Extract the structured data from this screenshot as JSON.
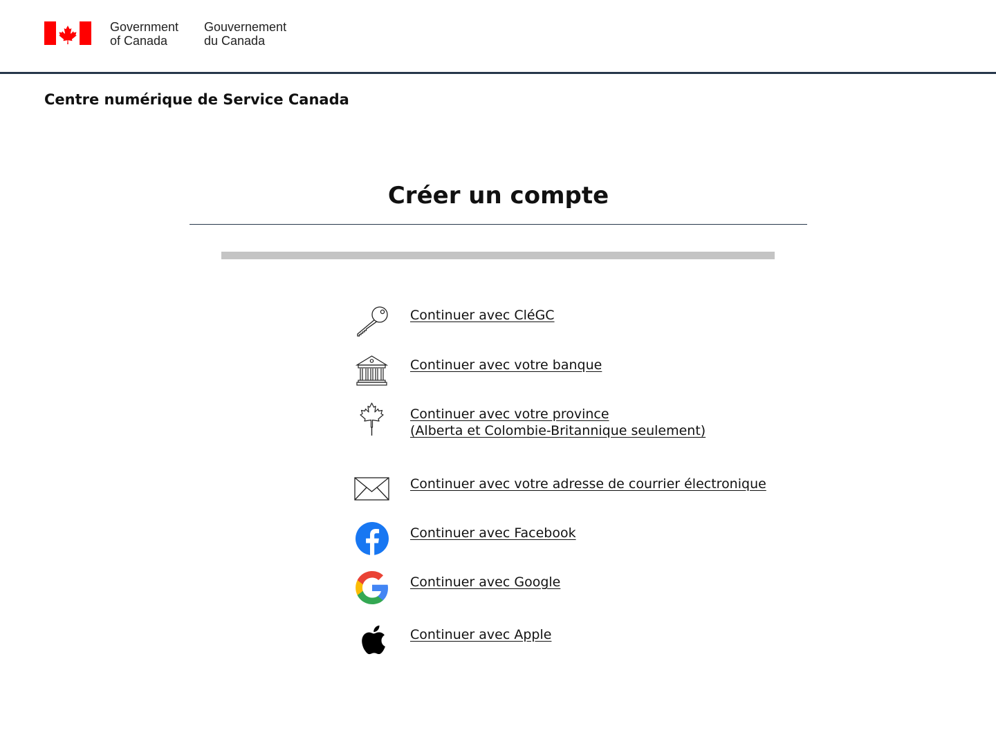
{
  "header": {
    "signature_en_line1": "Government",
    "signature_en_line2": "of Canada",
    "signature_fr_line1": "Gouvernement",
    "signature_fr_line2": "du Canada",
    "flag_color": "#ff0000"
  },
  "site_title": "Centre numérique de Service Canada",
  "page_heading": "Créer un compte",
  "progress": {
    "percent": 0,
    "track_color": "#c4c4c4"
  },
  "options": [
    {
      "icon": "key-icon",
      "label": "Continuer avec CléGC"
    },
    {
      "icon": "bank-icon",
      "label": "Continuer avec votre banque"
    },
    {
      "icon": "maple-leaf-icon",
      "label_line1": "Continuer avec votre province ",
      "label_line2": "(Alberta et Colombie-Britannique seulement)"
    },
    {
      "icon": "envelope-icon",
      "label": "Continuer avec votre adresse de courrier électronique"
    },
    {
      "icon": "facebook-icon",
      "label": "Continuer avec Facebook",
      "color": "#1877f2"
    },
    {
      "icon": "google-icon",
      "label": "Continuer avec Google"
    },
    {
      "icon": "apple-icon",
      "label": "Continuer avec Apple"
    }
  ]
}
